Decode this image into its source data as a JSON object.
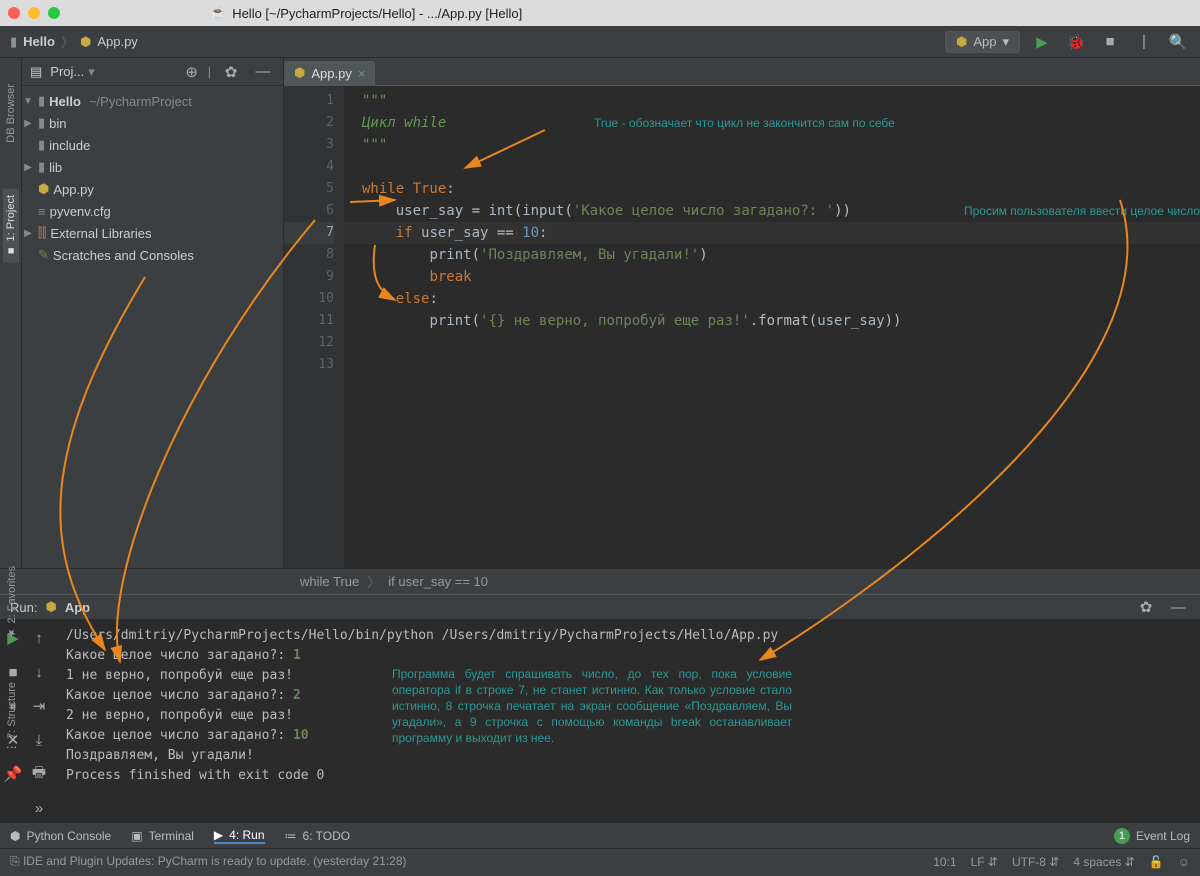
{
  "titlebar": "Hello [~/PycharmProjects/Hello] - .../App.py [Hello]",
  "breadcrumb": {
    "project": "Hello",
    "file": "App.py"
  },
  "runconfig": "App",
  "sidebar": {
    "title": "Proj...",
    "root": {
      "name": "Hello",
      "path": "~/PycharmProject"
    },
    "items": [
      "bin",
      "include",
      "lib"
    ],
    "files": [
      "App.py",
      "pyvenv.cfg"
    ],
    "ext": "External Libraries",
    "scratch": "Scratches and Consoles"
  },
  "tab": "App.py",
  "code": {
    "lines": [
      "\"\"\"",
      "Цикл while",
      "\"\"\"",
      "",
      "while True:",
      "    user_say = int(input('Какое целое число загадано?: '))",
      "    if user_say == 10:",
      "        print('Поздравляем, Вы угадали!')",
      "        break",
      "    else:",
      "        print('{} не верно, попробуй еще раз!'.format(user_say))",
      "",
      ""
    ],
    "nums": [
      "1",
      "2",
      "3",
      "4",
      "5",
      "6",
      "7",
      "8",
      "9",
      "10",
      "11",
      "12",
      "13"
    ],
    "current_line": 7
  },
  "annotations": {
    "a1": "True - обозначает что цикл не закончится сам по себе",
    "a2": "Просим пользователя ввести целое число",
    "a3": "Программа будет спрашивать число, до тех пор, пока условие оператора if в строке 7, не станет истинно. Как только условие стало истинно, 8 строчка печатает на экран сообщение «Поздравляем, Вы угадали», а 9 строчка с помощью команды break останавливает программу и выходит из нее."
  },
  "crumb": {
    "a": "while True",
    "b": "if user_say == 10"
  },
  "run": {
    "title": "Run:",
    "name": "App",
    "cmd": "/Users/dmitriy/PycharmProjects/Hello/bin/python /Users/dmitriy/PycharmProjects/Hello/App.py",
    "lines": [
      {
        "prompt": "Какое целое число загадано?:",
        "input": "1"
      },
      {
        "text": "1 не верно, попробуй еще раз!"
      },
      {
        "prompt": "Какое целое число загадано?:",
        "input": "2"
      },
      {
        "text": "2 не верно, попробуй еще раз!"
      },
      {
        "prompt": "Какое целое число загадано?:",
        "input": "10"
      },
      {
        "text": "Поздравляем, Вы угадали!"
      },
      {
        "blank": ""
      },
      {
        "text": "Process finished with exit code 0"
      }
    ]
  },
  "bottomtabs": {
    "pc": "Python Console",
    "term": "Terminal",
    "run": "4: Run",
    "todo": "6: TODO",
    "event": "Event Log",
    "badge": "1"
  },
  "status": {
    "msg": "IDE and Plugin Updates: PyCharm is ready to update. (yesterday 21:28)",
    "pos": "10:1",
    "lf": "LF",
    "enc": "UTF-8",
    "indent": "4 spaces"
  },
  "lefttabs": {
    "db": "DB Browser",
    "proj": "1: Project",
    "fav": "2: Favorites",
    "struct": "7: Structure"
  }
}
